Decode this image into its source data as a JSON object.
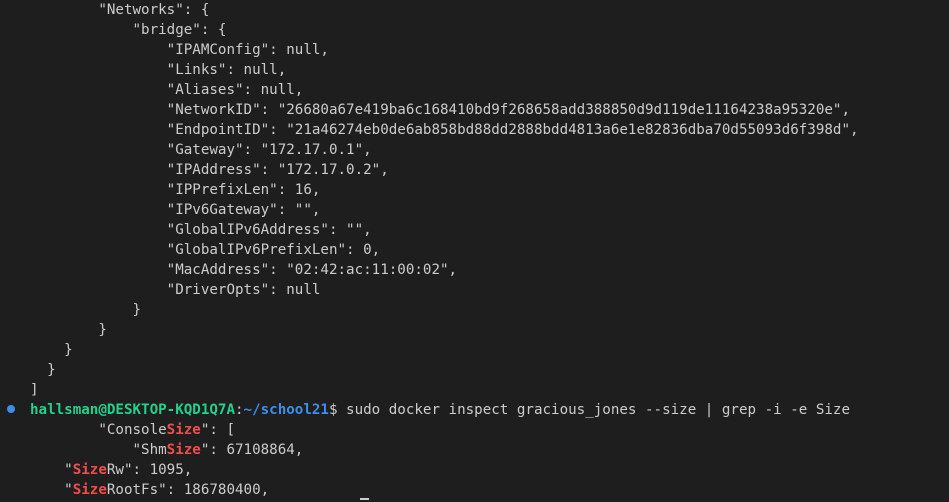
{
  "terminal": {
    "lines": [
      "        \"Networks\": {",
      "            \"bridge\": {",
      "                \"IPAMConfig\": null,",
      "                \"Links\": null,",
      "                \"Aliases\": null,",
      "                \"NetworkID\": \"26680a67e419ba6c168410bd9f268658add388850d9d119de11164238a95320e\",",
      "                \"EndpointID\": \"21a46274eb0de6ab858bd88dd2888bdd4813a6e1e82836dba70d55093d6f398d\",",
      "                \"Gateway\": \"172.17.0.1\",",
      "                \"IPAddress\": \"172.17.0.2\",",
      "                \"IPPrefixLen\": 16,",
      "                \"IPv6Gateway\": \"\",",
      "                \"GlobalIPv6Address\": \"\",",
      "                \"GlobalIPv6PrefixLen\": 0,",
      "                \"MacAddress\": \"02:42:ac:11:00:02\",",
      "                \"DriverOpts\": null",
      "            }",
      "        }",
      "    }",
      "  }",
      "]"
    ],
    "prompt": {
      "user_host": "hallsman@DESKTOP-KQD1Q7A",
      "separator": ":",
      "path": "~/school21",
      "symbol": "$",
      "command": " sudo docker inspect gracious_jones --size | grep -i -e Size"
    },
    "grep_results": [
      {
        "before": "        \"Console",
        "match": "Size",
        "after": "\": ["
      },
      {
        "before": "            \"Shm",
        "match": "Size",
        "after": "\": 67108864,"
      },
      {
        "before": "    \"",
        "match": "Size",
        "after": "Rw\": 1095,"
      },
      {
        "before": "    \"",
        "match": "Size",
        "after": "RootFs\": 186780400,"
      }
    ],
    "colors": {
      "background": "#1e1e1e",
      "foreground": "#cccccc",
      "match_highlight": "#f14c4c",
      "prompt_user": "#23d18b",
      "prompt_path": "#3b8eea",
      "command_decoration": "#3b8eea"
    }
  }
}
